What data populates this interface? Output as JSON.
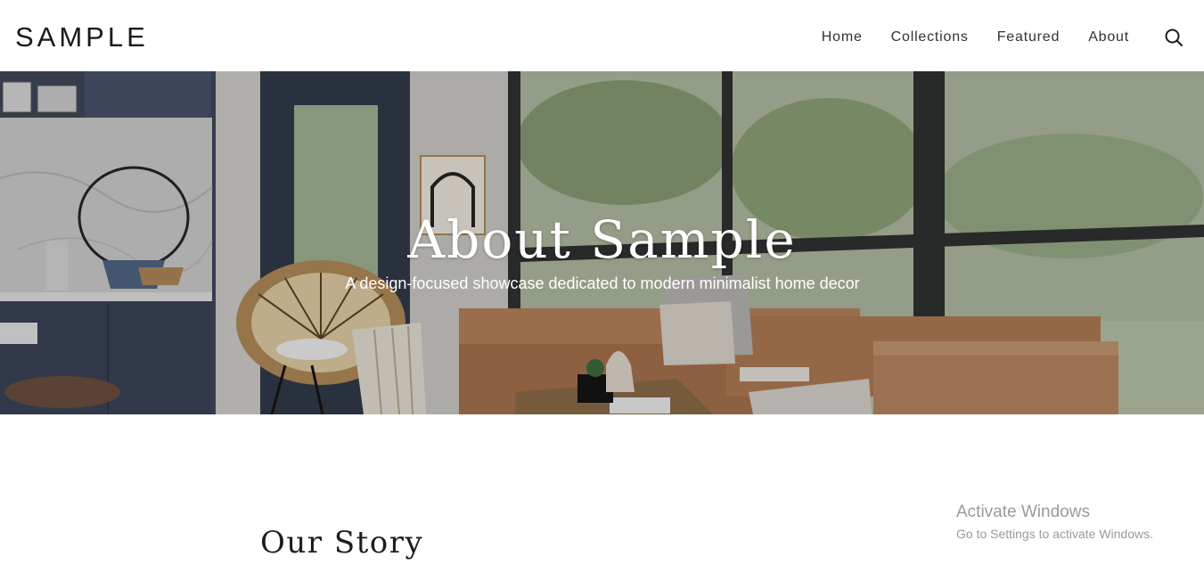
{
  "site": {
    "logo": "SAMPLE"
  },
  "nav": {
    "items": [
      {
        "label": "Home"
      },
      {
        "label": "Collections"
      },
      {
        "label": "Featured"
      },
      {
        "label": "About"
      }
    ],
    "search_icon": "search-icon"
  },
  "hero": {
    "title": "About Sample",
    "subtitle": "A design-focused showcase dedicated to modern minimalist home decor",
    "image": "living-room-photo"
  },
  "story": {
    "title": "Our Story"
  },
  "watermark": {
    "title": "Activate Windows",
    "subtitle": "Go to Settings to activate Windows."
  }
}
